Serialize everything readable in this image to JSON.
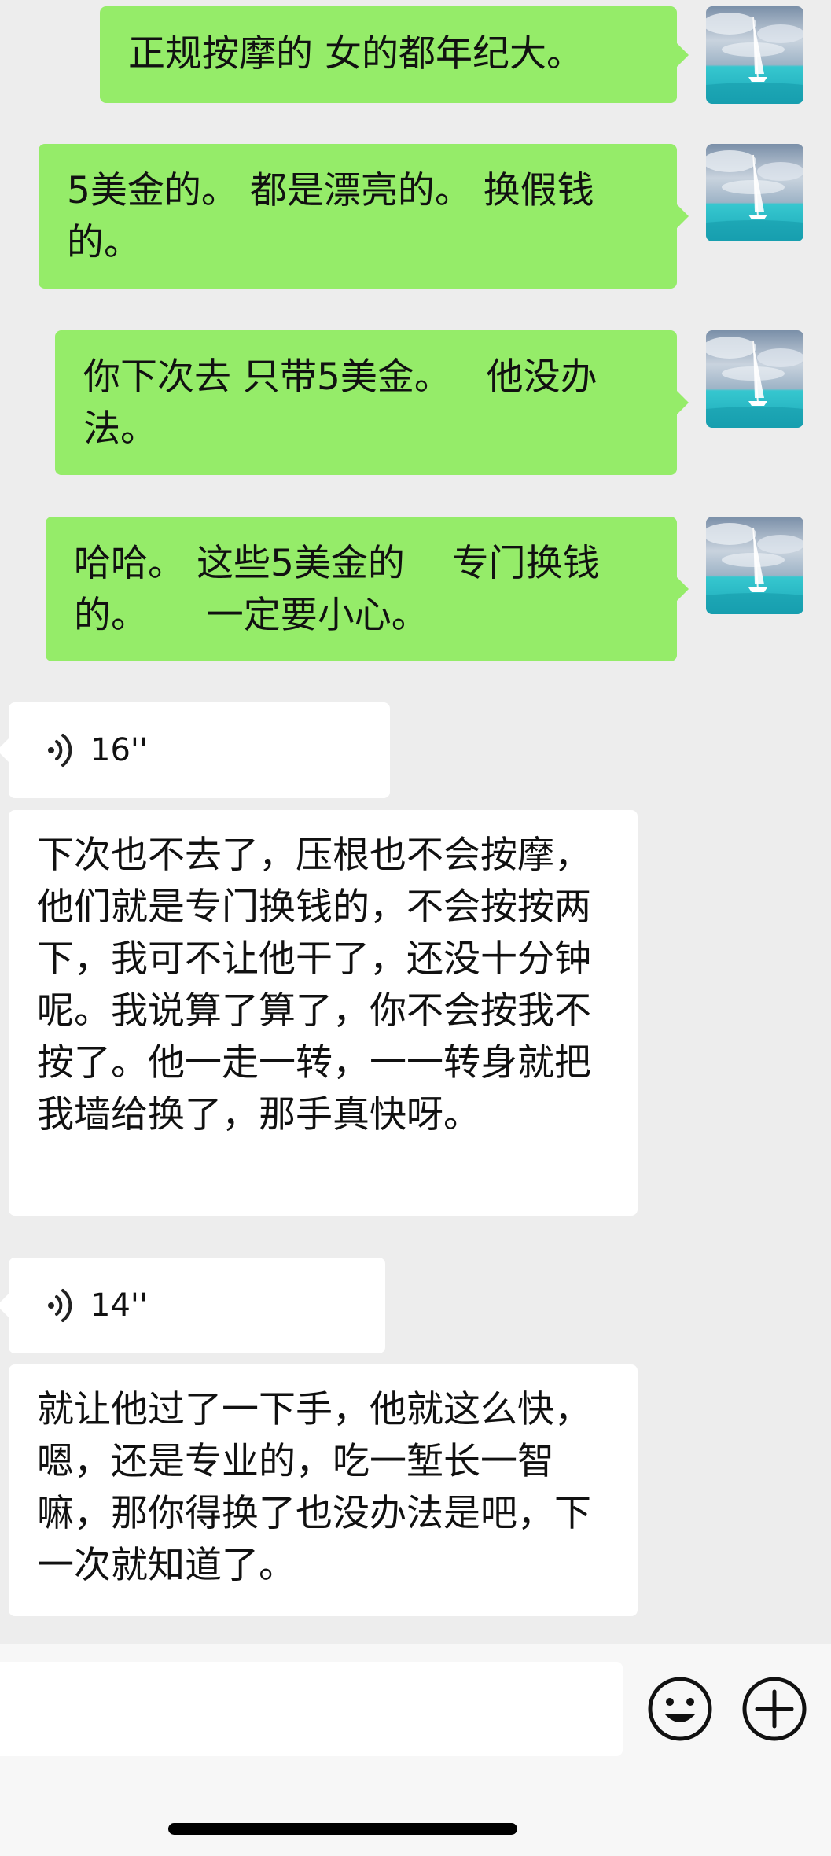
{
  "messages": [
    {
      "side": "sent",
      "text": "正规按摩的 女的都年纪大。"
    },
    {
      "side": "sent",
      "text": "5美金的。 都是漂亮的。 换假钱的。"
    },
    {
      "side": "sent",
      "text": "你下次去 只带5美金。   他没办法。"
    },
    {
      "side": "sent",
      "text": "哈哈。 这些5美金的    专门换钱的。     一定要小心。"
    },
    {
      "side": "received",
      "type": "voice",
      "duration": "16''"
    },
    {
      "side": "received",
      "type": "voice-text",
      "text": "下次也不去了，压根也不会按摩，他们就是专门换钱的，不会按按两下，我可不让他干了，还没十分钟呢。我说算了算了，你不会按我不按了。他一走一转，一一转身就把我墙给换了，那手真快呀。"
    },
    {
      "side": "received",
      "type": "voice",
      "duration": "14''"
    },
    {
      "side": "received",
      "type": "voice-text",
      "text": "就让他过了一下手，他就这么快，嗯，还是专业的，吃一堑长一智嘛，那你得换了也没办法是吧，下一次就知道了。"
    }
  ],
  "icons": {
    "avatar": "sailboat-photo-avatar",
    "voice": "voice-wave-icon",
    "emoji": "emoji-icon",
    "plus": "plus-icon"
  },
  "colors": {
    "sent_bubble": "#95ec69",
    "received_bubble": "#ffffff",
    "background": "#ededed"
  }
}
